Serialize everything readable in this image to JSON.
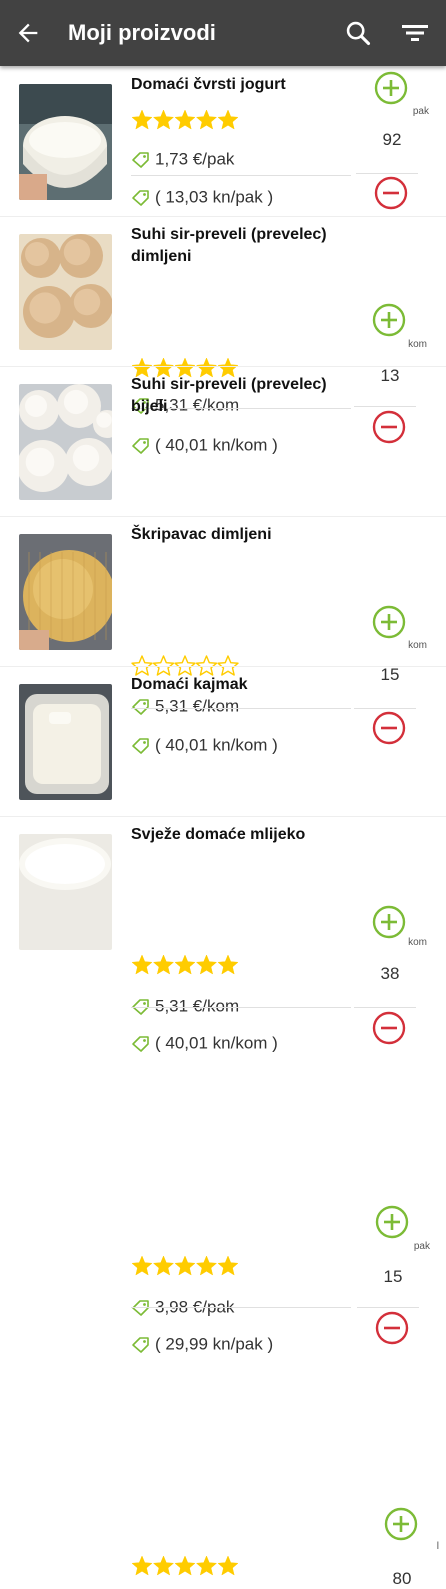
{
  "appbar": {
    "title": "Moji proizvodi",
    "back_icon": "arrow-left-icon",
    "search_icon": "search-icon",
    "filter_icon": "filter-icon",
    "background": "#424242"
  },
  "colors": {
    "plus": "#7cbb36",
    "minus": "#d32f3a",
    "star": "#ffcc00"
  },
  "products": [
    {
      "name": "Domaći čvrsti jogurt",
      "rating": 5,
      "price_eur": "1,73 €/pak",
      "price_kn": "( 13,03 kn/pak )",
      "unit": "pak",
      "qty": "92",
      "image": "yogurt-bowl"
    },
    {
      "name": "Suhi sir-preveli (prevelec) dimljeni",
      "rating": 5,
      "price_eur": "5,31 €/kom",
      "price_kn": "( 40,01 kn/kom )",
      "unit": "kom",
      "qty": "13",
      "image": "smoked-cheese-balls"
    },
    {
      "name": "Suhi sir-preveli (prevelec) bijeli",
      "rating": 0,
      "price_eur": "5,31 €/kom",
      "price_kn": "( 40,01 kn/kom )",
      "unit": "kom",
      "qty": "15",
      "image": "white-cheese-balls"
    },
    {
      "name": "Škripavac dimljeni",
      "rating": 5,
      "price_eur": "5,31 €/kom",
      "price_kn": "( 40,01 kn/kom )",
      "unit": "kom",
      "qty": "38",
      "image": "smoked-skripavac"
    },
    {
      "name": "Domaći kajmak",
      "rating": 5,
      "price_eur": "3,98 €/pak",
      "price_kn": "( 29,99 kn/pak )",
      "unit": "pak",
      "qty": "15",
      "image": "kajmak-container"
    },
    {
      "name": "Svježe domaće mlijeko",
      "rating": 5,
      "price_eur": "",
      "price_kn": "",
      "unit": "l",
      "qty": "80",
      "image": "milk-bowl"
    }
  ]
}
